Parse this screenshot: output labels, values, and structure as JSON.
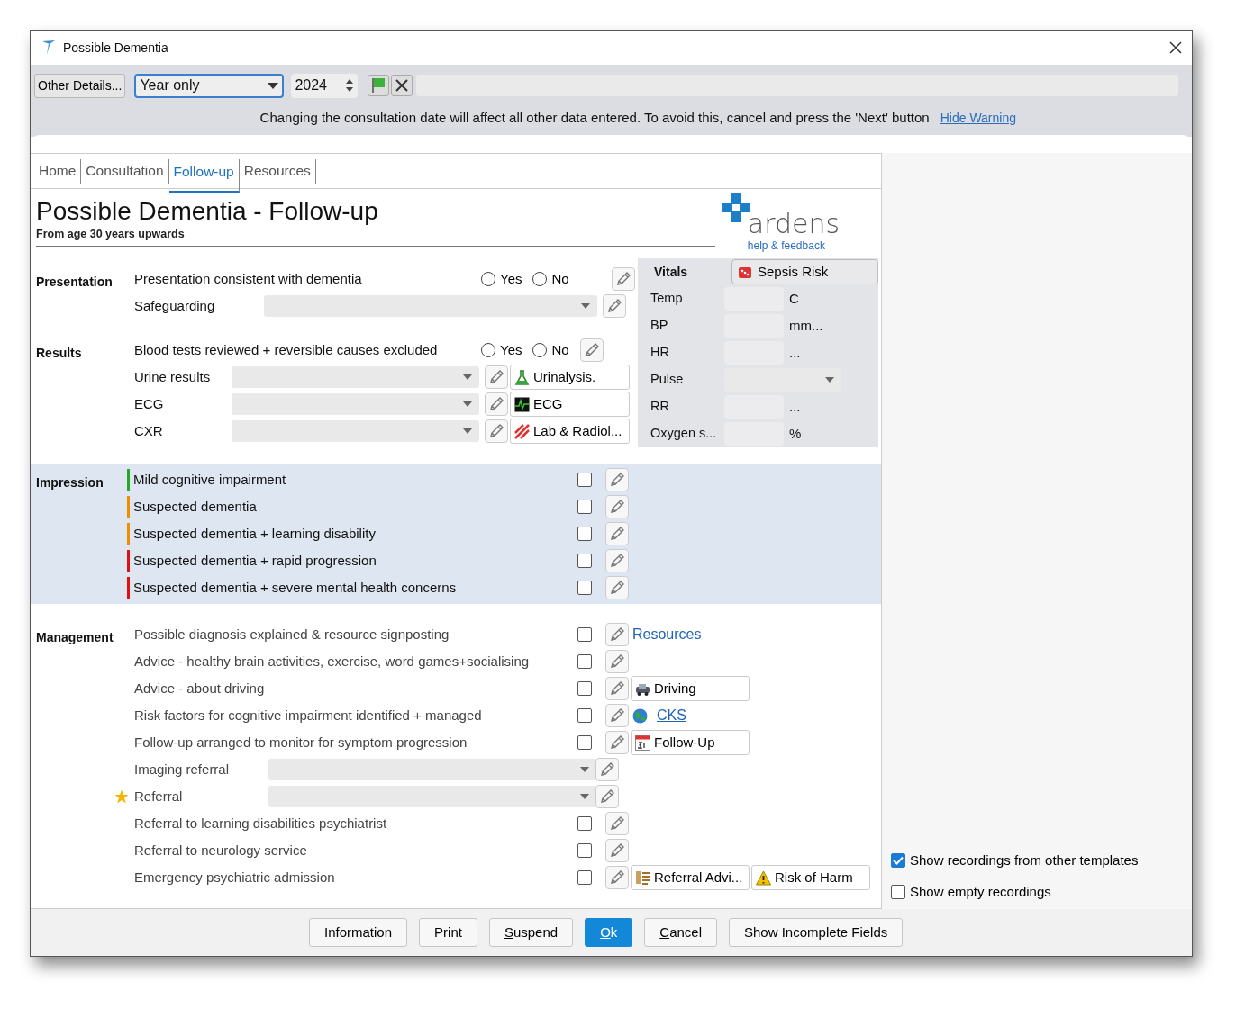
{
  "window": {
    "title": "Possible Dementia"
  },
  "toolbar": {
    "other_details_button": "Other Details...",
    "date_mode": "Year only",
    "year": "2024",
    "warning": "Changing the consultation date will affect all other data entered. To avoid this, cancel and press the 'Next' button",
    "hide_warning_link": "Hide Warning"
  },
  "tabs": [
    {
      "label": "Home",
      "selected": false
    },
    {
      "label": "Consultation",
      "selected": false
    },
    {
      "label": "Follow-up",
      "selected": true
    },
    {
      "label": "Resources",
      "selected": false
    }
  ],
  "header": {
    "title": "Possible Dementia - Follow-up",
    "subtitle": "From age 30 years upwards",
    "logo_text": "ardens",
    "help_link": "help & feedback"
  },
  "presentation": {
    "label": "Presentation",
    "rows": [
      {
        "kind": "yes_no",
        "text": "Presentation consistent with dementia",
        "options": [
          {
            "label": "Yes",
            "selected": false
          },
          {
            "label": "No",
            "selected": false
          }
        ]
      },
      {
        "kind": "dropdown",
        "text": "Safeguarding"
      }
    ]
  },
  "results": {
    "label": "Results",
    "rows": [
      {
        "kind": "yes_no",
        "text": "Blood tests reviewed + reversible causes excluded",
        "options": [
          {
            "label": "Yes",
            "selected": false
          },
          {
            "label": "No",
            "selected": false
          }
        ]
      },
      {
        "kind": "dropdown",
        "text": "Urine results",
        "action": "Urinalysis."
      },
      {
        "kind": "dropdown",
        "text": "ECG",
        "action": "ECG"
      },
      {
        "kind": "dropdown",
        "text": "CXR",
        "action": "Lab & Radiol..."
      }
    ]
  },
  "vitals": {
    "title": "Vitals",
    "sepsis_button": "Sepsis Risk",
    "rows": [
      {
        "kind": "number",
        "label": "Temp",
        "unit": "C"
      },
      {
        "kind": "number",
        "label": "BP",
        "unit": "mm..."
      },
      {
        "kind": "number",
        "label": "HR",
        "unit": "..."
      },
      {
        "kind": "dropdown",
        "label": "Pulse"
      },
      {
        "kind": "number",
        "label": "RR",
        "unit": "..."
      },
      {
        "kind": "number",
        "label": "Oxygen s...",
        "unit": "%"
      }
    ]
  },
  "impression": {
    "label": "Impression",
    "rows": [
      {
        "text": "Mild cognitive impairment",
        "color": "#22a822",
        "checked": false
      },
      {
        "text": "Suspected dementia",
        "color": "#f08c00",
        "checked": false
      },
      {
        "text": "Suspected dementia + learning disability",
        "color": "#f08c00",
        "checked": false
      },
      {
        "text": "Suspected dementia + rapid progression",
        "color": "#e01010",
        "checked": false
      },
      {
        "text": "Suspected dementia + severe mental health concerns",
        "color": "#e01010",
        "checked": false
      }
    ]
  },
  "management": {
    "label": "Management",
    "rows": [
      {
        "kind": "check",
        "text": "Possible diagnosis explained & resource signposting",
        "checked": false,
        "starred": false,
        "actions": [
          {
            "kind": "link",
            "label": "Resources"
          }
        ]
      },
      {
        "kind": "check",
        "text": "Advice - healthy brain activities, exercise, word games+socialising",
        "checked": false,
        "starred": false
      },
      {
        "kind": "check",
        "text": "Advice - about driving",
        "checked": false,
        "starred": false,
        "actions": [
          {
            "kind": "button",
            "label": "Driving"
          }
        ]
      },
      {
        "kind": "check",
        "text": "Risk factors for cognitive impairment identified + managed",
        "checked": false,
        "starred": false,
        "actions": [
          {
            "kind": "icon_link",
            "label": "CKS"
          }
        ]
      },
      {
        "kind": "check",
        "text": "Follow-up arranged to monitor for symptom progression",
        "checked": false,
        "starred": false,
        "actions": [
          {
            "kind": "button",
            "label": "Follow-Up"
          }
        ]
      },
      {
        "kind": "dropdown",
        "text": "Imaging referral",
        "starred": false
      },
      {
        "kind": "dropdown",
        "text": "Referral",
        "starred": true
      },
      {
        "kind": "check",
        "text": "Referral to learning disabilities psychiatrist",
        "checked": false,
        "starred": false
      },
      {
        "kind": "check",
        "text": "Referral to neurology service",
        "checked": false,
        "starred": false
      },
      {
        "kind": "check",
        "text": "Emergency psychiatric admission",
        "checked": false,
        "starred": false,
        "actions": [
          {
            "kind": "button",
            "label": "Referral Advi..."
          },
          {
            "kind": "button",
            "label": "Risk of Harm"
          }
        ]
      }
    ]
  },
  "options": [
    {
      "label": "Show recordings from other templates",
      "checked": true
    },
    {
      "label": "Show empty recordings",
      "checked": false
    }
  ],
  "buttons": [
    {
      "label": "Information",
      "default": false,
      "underline_first": false
    },
    {
      "label": "Print",
      "default": false,
      "underline_first": false
    },
    {
      "label": "Suspend",
      "default": false,
      "underline_first": true
    },
    {
      "label": "Ok",
      "default": true,
      "underline_first": true
    },
    {
      "label": "Cancel",
      "default": false,
      "underline_first": true
    },
    {
      "label": "Show Incomplete Fields",
      "default": false,
      "underline_first": false
    }
  ]
}
